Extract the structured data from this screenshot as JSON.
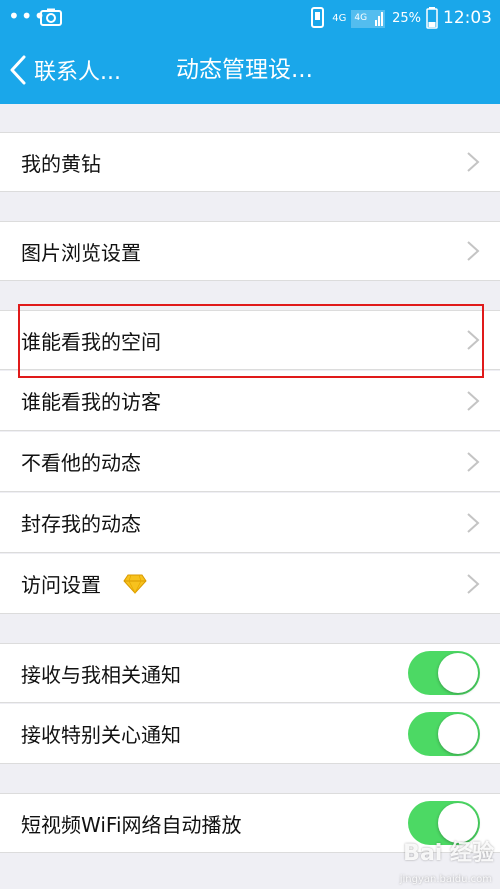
{
  "status_bar": {
    "network": "4G",
    "network2": "4G",
    "battery": "25%",
    "time": "12:03"
  },
  "nav": {
    "back_label": "联系人...",
    "title": "动态管理设..."
  },
  "rows": {
    "my_yellow_diamond": "我的黄钻",
    "image_browse_settings": "图片浏览设置",
    "who_can_see_space": "谁能看我的空间",
    "who_can_see_visitors": "谁能看我的访客",
    "hide_their_feed": "不看他的动态",
    "archive_my_feed": "封存我的动态",
    "visit_settings": "访问设置",
    "receive_related_notifications": "接收与我相关通知",
    "receive_special_care_notifications": "接收特别关心通知",
    "short_video_wifi_autoplay": "短视频WiFi网络自动播放"
  },
  "toggles": {
    "receive_related_notifications": true,
    "receive_special_care_notifications": true,
    "short_video_wifi_autoplay": true
  },
  "colors": {
    "brand": "#1aa7ea",
    "toggle_on": "#4cd964",
    "highlight": "#e01a1a"
  },
  "watermark": {
    "brand": "Bai 经验",
    "url": "jingyan.baidu.com"
  }
}
